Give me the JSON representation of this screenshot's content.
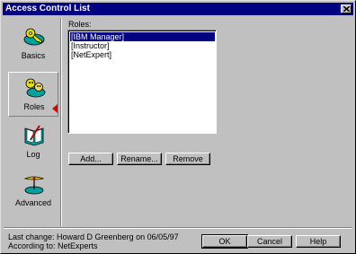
{
  "window": {
    "title": "Access Control List"
  },
  "sidebar": {
    "items": [
      {
        "label": "Basics",
        "icon": "key-icon"
      },
      {
        "label": "Roles",
        "icon": "people-icon",
        "selected": true
      },
      {
        "label": "Log",
        "icon": "book-icon"
      },
      {
        "label": "Advanced",
        "icon": "propeller-icon"
      }
    ]
  },
  "roles": {
    "label": "Roles:",
    "items": [
      "[IBM Manager]",
      "[Instructor]",
      "[NetExpert]"
    ],
    "selected_index": 0
  },
  "actions": {
    "add": "Add...",
    "rename": "Rename...",
    "remove": "Remove"
  },
  "footer": {
    "last_change": "Last change: Howard D Greenberg on 06/05/97",
    "according": "According to: NetExperts",
    "ok": "OK",
    "cancel": "Cancel",
    "help": "Help"
  },
  "colors": {
    "titlebar": "#000080",
    "selection": "#000080",
    "indicator": "#e00000"
  }
}
